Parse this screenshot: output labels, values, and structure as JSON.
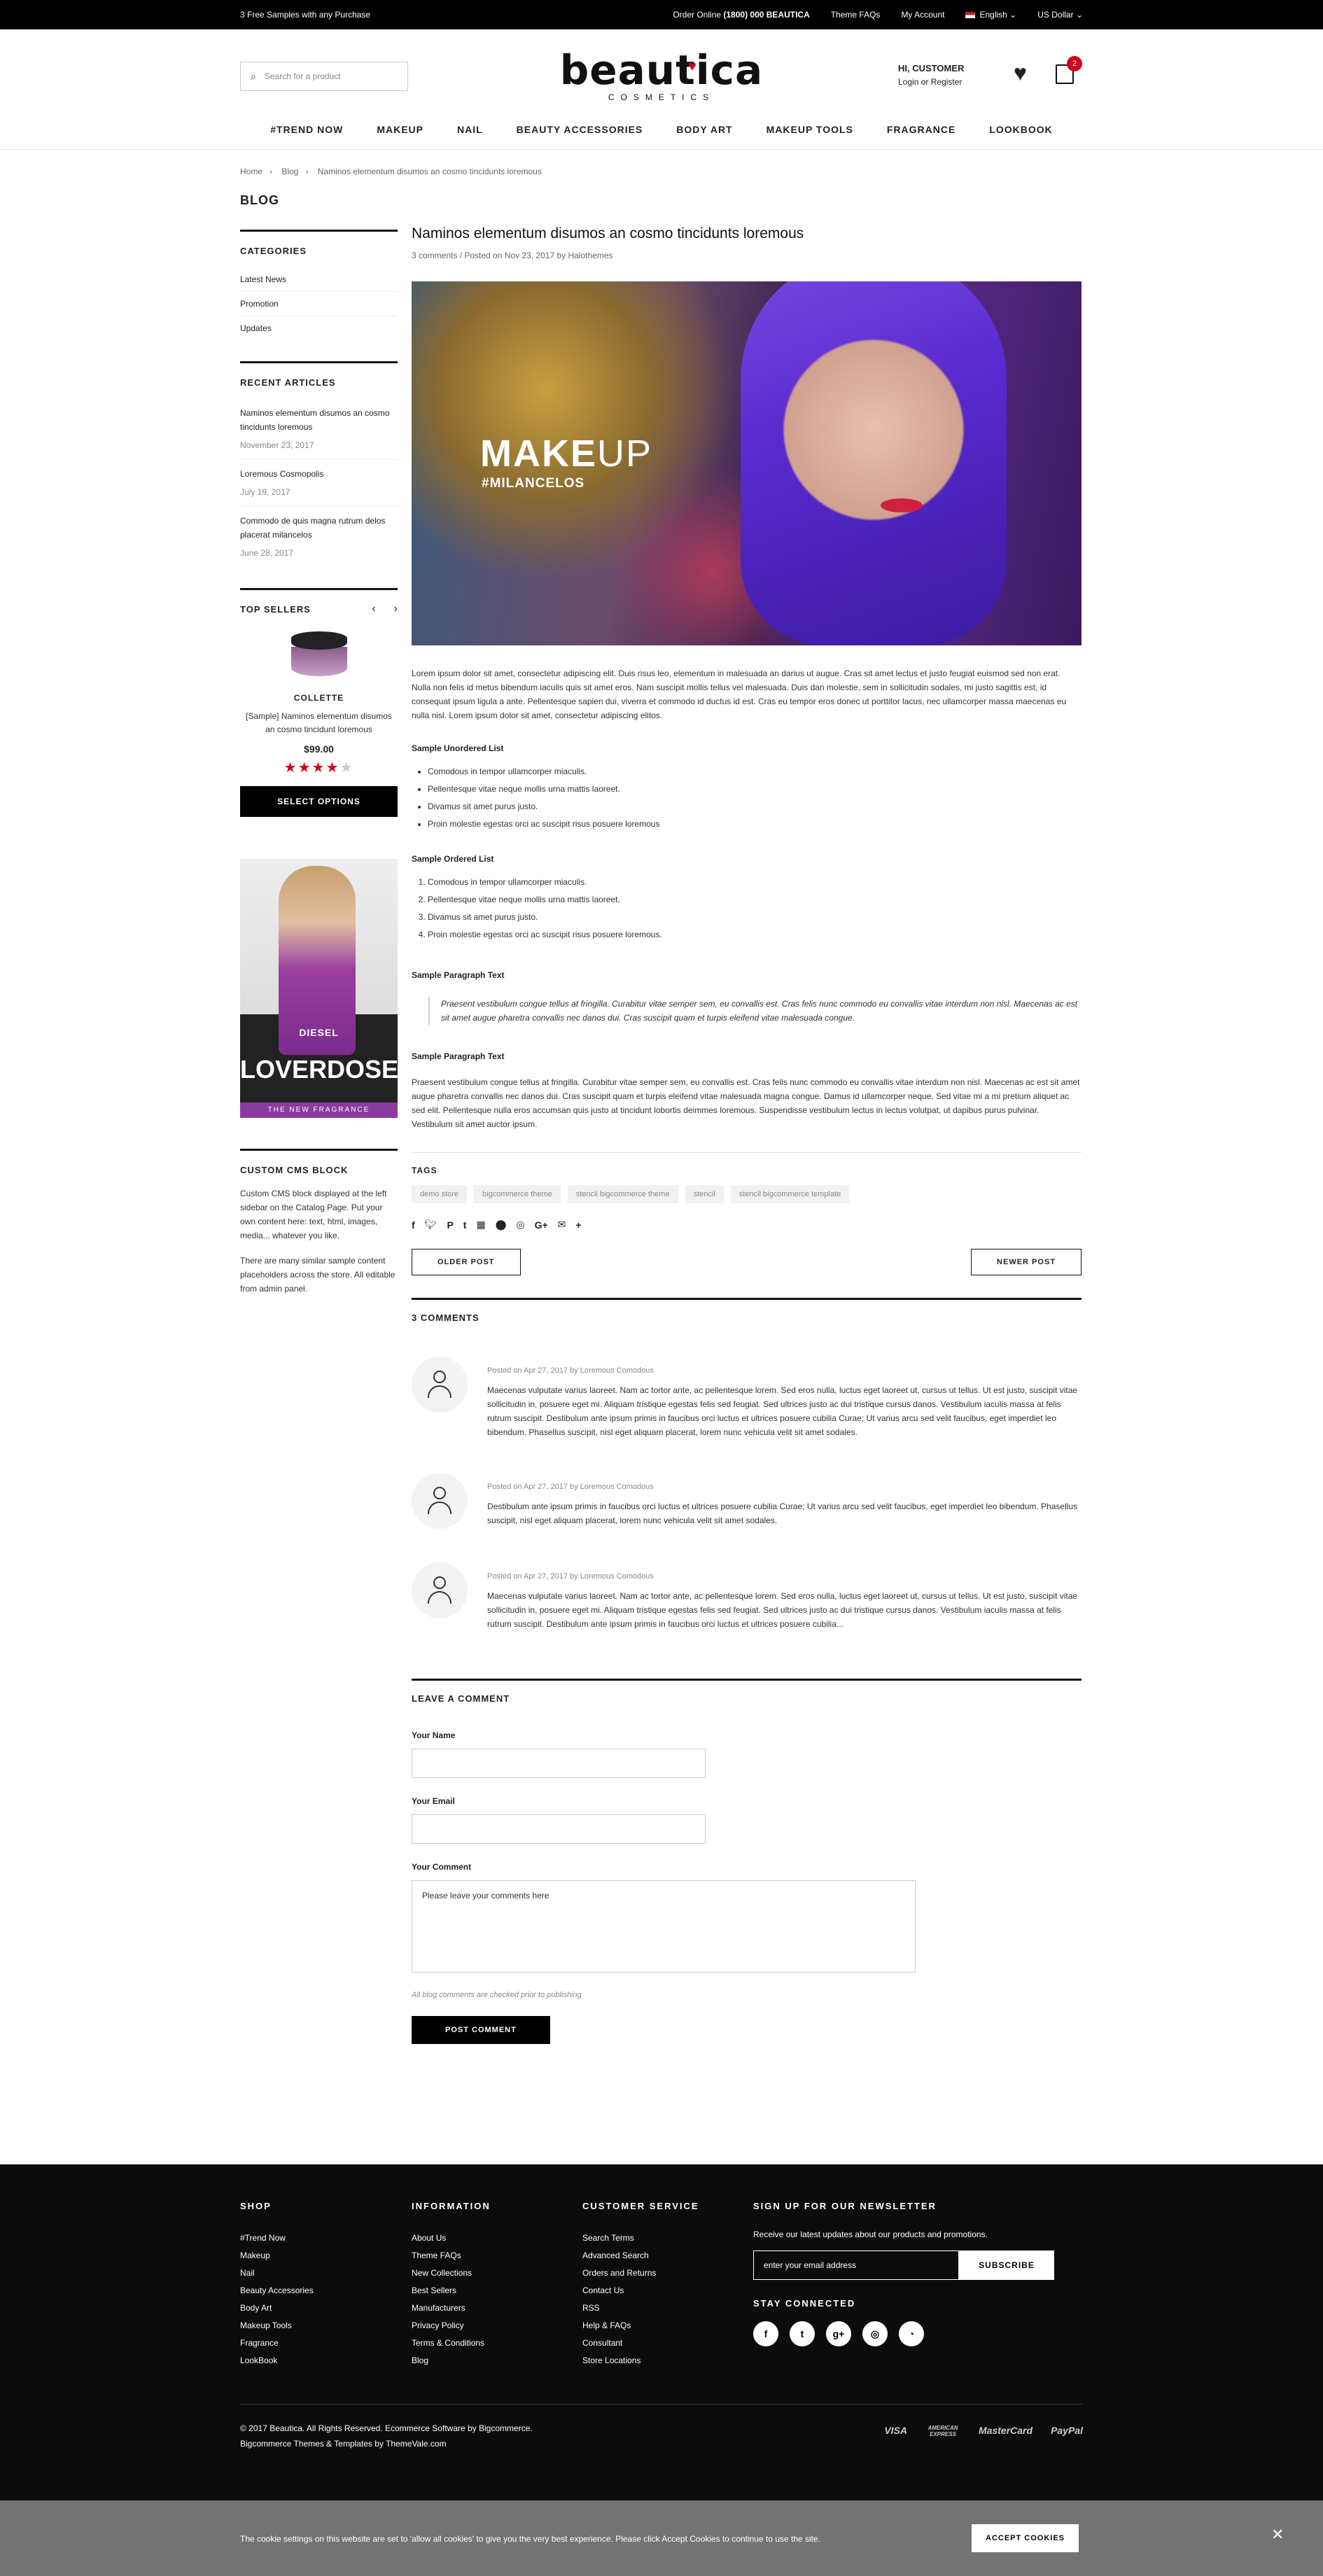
{
  "topbar": {
    "promo": "3 Free Samples with any Purchase",
    "order_label": "Order Online",
    "phone": "(1800) 000 BEAUTICA",
    "theme_faqs": "Theme FAQs",
    "my_account": "My Account",
    "language": "English",
    "currency": "US Dollar"
  },
  "header": {
    "search_placeholder": "Search for a product",
    "logo_name": "beautica",
    "logo_sub": "COSMETICS",
    "greeting": "HI, CUSTOMER",
    "login": "Login",
    "or": "or",
    "register": "Register",
    "cart_count": "2"
  },
  "nav": [
    "#TREND NOW",
    "MAKEUP",
    "NAIL",
    "BEAUTY ACCESSORIES",
    "BODY ART",
    "MAKEUP TOOLS",
    "FRAGRANCE",
    "LOOKBOOK"
  ],
  "breadcrumb": [
    "Home",
    "Blog",
    "Naminos elementum disumos an cosmo tincidunts loremous"
  ],
  "page_title": "BLOG",
  "sidebar": {
    "categories_title": "CATEGORIES",
    "categories": [
      "Latest News",
      "Promotion",
      "Updates"
    ],
    "recent_title": "RECENT ARTICLES",
    "recent": [
      {
        "title": "Naminos elementum disumos an cosmo tincidunts loremous",
        "date": "November 23, 2017"
      },
      {
        "title": "Loremous Cosmopolis",
        "date": "July 19, 2017"
      },
      {
        "title": "Commodo de quis magna rutrum delos placerat milancelos",
        "date": "June 28, 2017"
      }
    ],
    "top_sellers_title": "TOP SELLERS",
    "product": {
      "brand": "COLLETTE",
      "name": "[Sample] Naminos elementum disumos an cosmo tincidunt loremous",
      "price": "$99.00",
      "rating": 4,
      "button": "SELECT OPTIONS"
    },
    "banner": {
      "brand": "DIESEL",
      "title": "LOVERDOSE",
      "tagline": "THE NEW FRAGRANCE"
    },
    "cms_title": "CUSTOM CMS BLOCK",
    "cms_p1": "Custom CMS block displayed at the left sidebar on the Catalog Page. Put your own content here: text, html, images, media... whatever you like.",
    "cms_p2": "There are many similar sample content placeholders across the store. All editable from admin panel."
  },
  "post": {
    "title": "Naminos elementum disumos an cosmo tincidunts loremous",
    "meta": "3 comments / Posted on Nov 23, 2017 by Halothemes",
    "hero_make": "MAKE",
    "hero_up": "UP",
    "hero_tag": "#MILANCELOS",
    "intro": "Lorem ipsum dolor sit amet, consectetur adipiscing elit. Duis risus leo, elementum in malesuada an darius ut augue. Cras sit amet lectus et justo feugiat euismod sed non erat. Nulla non felis id metus bibendum iaculis quis sit amet eros. Nam suscipit mollis tellus vel malesuada. Duis dan molestie, sem in sollicitudin sodales, mi justo sagittis est, id consequat ipsum ligula a ante. Pellentesque sapien dui, viverra et commodo id ductus id est. Cras eu tempor eros donec ut porttitor lacus, nec ullamcorper massa maecenas eu nulla nisl. Lorem ipsum dolor sit amet, consectetur adipiscing elitos.",
    "ul_title": "Sample Unordered List",
    "ul_items": [
      "Comodous in tempor ullamcorper miaculis.",
      "Pellentesque vitae neque mollis urna mattis laoreet.",
      "Divamus sit amet purus justo.",
      "Proin molestie egestas orci ac suscipit risus posuere loremous"
    ],
    "ol_title": "Sample Ordered List",
    "ol_items": [
      "Comodous in tempor ullamcorper miaculis.",
      "Pellentesque vitae neque mollis urna mattis laoreet.",
      "Divamus sit amet purus justo.",
      "Proin molestie egestas orci ac suscipit risus posuere loremous."
    ],
    "p1_title": "Sample Paragraph Text",
    "quote": "Praesent vestibulum congue tellus at fringilla. Curabitur vitae semper sem, eu convallis est. Cras felis nunc commodo eu convallis vitae interdum non nisl. Maecenas ac est sit amet augue pharetra convallis nec danos dui. Cras suscipit quam et turpis eleifend vitae malesuada congue.",
    "p2_title": "Sample Paragraph Text",
    "p2": "Praesent vestibulum congue tellus at fringilla. Curabitur vitae semper sem, eu convallis est. Cras felis nunc commodo eu convallis vitae interdum non nisl. Maecenas ac est sit amet augue pharetra convallis nec danos dui. Cras suscipit quam et turpis eleifend vitae malesuada magna congue. Damus id ullamcorper neque. Sed vitae mi a mi pretium aliquet ac sed elit. Pellentesque nulla eros accumsan quis justo at tincidunt lobortis deimmes loremous. Suspendisse vestibulum lectus in lectus volutpat, ut dapibus purus pulvinar. Vestibulum sit amet auctor ipsum.",
    "tags_title": "TAGS",
    "tags": [
      "demo store",
      "bigcommerce theme",
      "stencil bigcommerce theme",
      "stencil",
      "stencil bigcommerce template"
    ],
    "older": "OLDER POST",
    "newer": "NEWER POST"
  },
  "comments": {
    "title": "3 COMMENTS",
    "items": [
      {
        "meta": "Posted on Apr 27, 2017 by Loremous Comodous",
        "text": "Maecenas vulputate varius laoreet. Nam ac tortor ante, ac pellentesque lorem. Sed eros nulla, luctus eget laoreet ut, cursus ut tellus. Ut est justo, suscipit vitae sollicitudin in, posuere eget mi. Aliquam tristique egestas felis sed feugiat. Sed ultrices justo ac dui tristique cursus danos. Vestibulum iaculis massa at felis rutrum suscipit. Destibulum ante ipsum primis in faucibus orci luctus et ultrices posuere cubilia Curae; Ut varius arcu sed velit faucibus, eget imperdiet leo bibendum. Phasellus suscipit, nisl eget aliquam placerat, lorem nunc vehicula velit sit amet sodales."
      },
      {
        "meta": "Posted on Apr 27, 2017 by Loremous Comodous",
        "text": "Destibulum ante ipsum primis in faucibus orci luctus et ultrices posuere cubilia Curae; Ut varius arcu sed velit faucibus, eget imperdiet leo bibendum. Phasellus suscipit, nisl eget aliquam placerat, lorem nunc vehicula velit sit amet sodales."
      },
      {
        "meta": "Posted on Apr 27, 2017 by Loremous Comodous",
        "text": "Maecenas vulputate varius laoreet. Nam ac tortor ante, ac pellentesque lorem. Sed eros nulla, luctus eget laoreet ut, cursus ut tellus. Ut est justo, suscipit vitae sollicitudin in, posuere eget mi. Aliquam tristique egestas felis sed feugiat. Sed ultrices justo ac dui tristique cursus danos. Vestibulum iaculis massa at felis rutrum suscipit. Destibulum ante ipsum primis in faucibus orci luctus et ultrices posuere cubilia..."
      }
    ]
  },
  "form": {
    "title": "LEAVE A COMMENT",
    "name_label": "Your Name",
    "email_label": "Your Email",
    "comment_label": "Your Comment",
    "comment_placeholder": "Please leave your comments here",
    "note": "All blog comments are checked prior to publishing",
    "submit": "POST COMMENT"
  },
  "footer": {
    "shop_title": "SHOP",
    "shop": [
      "#Trend Now",
      "Makeup",
      "Nail",
      "Beauty Accessories",
      "Body Art",
      "Makeup Tools",
      "Fragrance",
      "LookBook"
    ],
    "info_title": "INFORMATION",
    "info": [
      "About Us",
      "Theme FAQs",
      "New Collections",
      "Best Sellers",
      "Manufacturers",
      "Privacy Policy",
      "Terms & Conditions",
      "Blog"
    ],
    "service_title": "CUSTOMER SERVICE",
    "service": [
      "Search Terms",
      "Advanced Search",
      "Orders and Returns",
      "Contact Us",
      "RSS",
      "Help & FAQs",
      "Consultant",
      "Store Locations"
    ],
    "newsletter_title": "SIGN UP FOR OUR NEWSLETTER",
    "newsletter_text": "Receive our latest updates about our products and promotions.",
    "email_placeholder": "enter your email address",
    "subscribe": "SUBSCRIBE",
    "stay_title": "STAY CONNECTED",
    "copy1": "© 2017 Beautica. All Rights Reserved. Ecommerce Software by Bigcommerce.",
    "copy2": "Bigcommerce Themes & Templates by ThemeVale.com",
    "payments": [
      "VISA",
      "AMERICAN EXPRESS",
      "MasterCard",
      "PayPal"
    ]
  },
  "cookie": {
    "text": "The cookie settings on this website are set to 'allow all cookies' to give you the very best experience. Please click Accept Cookies to continue to use the site.",
    "accept": "ACCEPT COOKIES",
    "close": "✕"
  },
  "colors": {
    "accent": "#d0021b",
    "dark": "#000000",
    "footer_bg": "#0c0c0c"
  }
}
